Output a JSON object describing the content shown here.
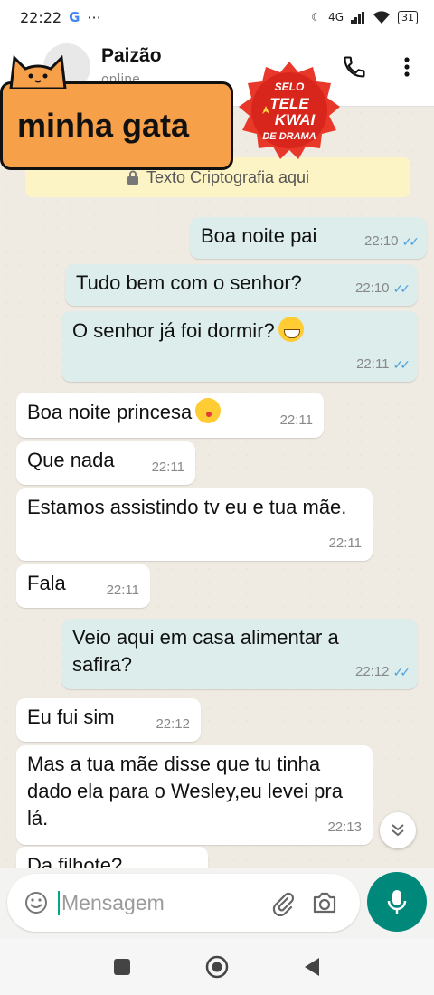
{
  "status_bar": {
    "time": "22:22",
    "g_badge": "G",
    "more": "···",
    "network": "4G",
    "battery": "31"
  },
  "header": {
    "contact_name": "Paizão",
    "contact_status": "online"
  },
  "overlay": {
    "label": "minha gata",
    "seal_top": "SELO",
    "seal_line1": "TELE",
    "seal_line2": "KWAI",
    "seal_bottom": "DE DRAMA"
  },
  "chat": {
    "encryption_notice": "Texto Criptografia aqui",
    "messages": [
      {
        "dir": "out",
        "text": "Boa noite pai",
        "time": "22:10"
      },
      {
        "dir": "out",
        "text": "Tudo bem com o senhor?",
        "time": "22:10"
      },
      {
        "dir": "out",
        "text": "O senhor já foi dormir?",
        "time": "22:11"
      },
      {
        "dir": "in",
        "text": "Boa noite princesa",
        "time": "22:11"
      },
      {
        "dir": "in",
        "text": "Que nada",
        "time": "22:11"
      },
      {
        "dir": "in",
        "text": "Estamos assistindo tv eu e tua mãe.",
        "time": "22:11"
      },
      {
        "dir": "in",
        "text": "Fala",
        "time": "22:11"
      },
      {
        "dir": "out",
        "text": "Veio aqui em casa alimentar a safira?",
        "time": "22:12"
      },
      {
        "dir": "in",
        "text": "Eu fui sim",
        "time": "22:12"
      },
      {
        "dir": "in",
        "text": "Mas a tua mãe disse que tu tinha dado ela para o Wesley,eu levei pra lá.",
        "time": "22:13"
      },
      {
        "dir": "in",
        "text": "Da filhote?",
        "time": ""
      }
    ]
  },
  "composer": {
    "placeholder": "Mensagem"
  },
  "icons": {
    "back": "arrow-left-icon",
    "call": "phone-icon",
    "menu": "more-vert-icon",
    "emoji": "emoji-icon",
    "attach": "paperclip-icon",
    "camera": "camera-icon",
    "mic": "mic-icon"
  },
  "colors": {
    "outgoing_bubble": "#dcedeb",
    "incoming_bubble": "#ffffff",
    "mic_button": "#00897b",
    "read_ticks": "#4fa3e0",
    "label_card": "#f7a04a"
  }
}
